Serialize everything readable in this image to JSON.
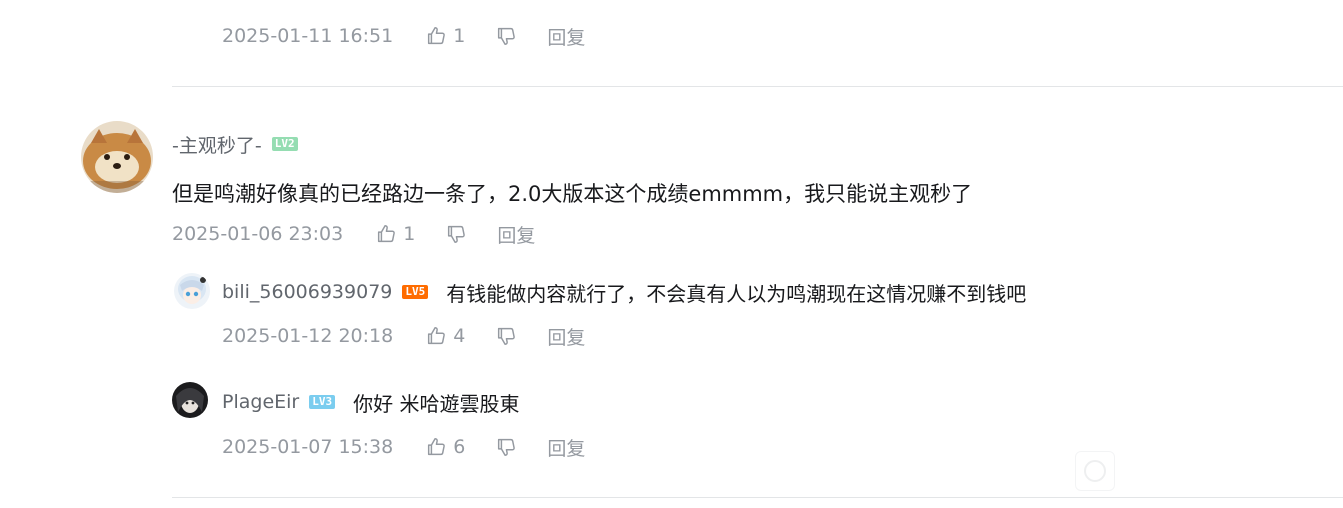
{
  "top_meta": {
    "time": "2025-01-11 16:51",
    "likes": "1",
    "reply": "回复"
  },
  "comment": {
    "username": "-主观秒了-",
    "level": "LV2",
    "level_color": "#95ddb2",
    "text": "但是鸣潮好像真的已经路边一条了，2.0大版本这个成绩emmmm，我只能说主观秒了",
    "time": "2025-01-06 23:03",
    "likes": "1",
    "reply": "回复"
  },
  "replies": [
    {
      "username": "bili_56006939079",
      "level": "LV5",
      "level_color": "#ff6c00",
      "text": "有钱能做内容就行了，不会真有人以为鸣潮现在这情况赚不到钱吧",
      "time": "2025-01-12 20:18",
      "likes": "4",
      "reply": "回复"
    },
    {
      "username": "PlageEir",
      "level": "LV3",
      "level_color": "#7bcdef",
      "text": "你好 米哈遊雲股東",
      "time": "2025-01-07 15:38",
      "likes": "6",
      "reply": "回复"
    }
  ],
  "icons": {
    "like": "thumb-up-icon",
    "dislike": "thumb-down-icon"
  }
}
